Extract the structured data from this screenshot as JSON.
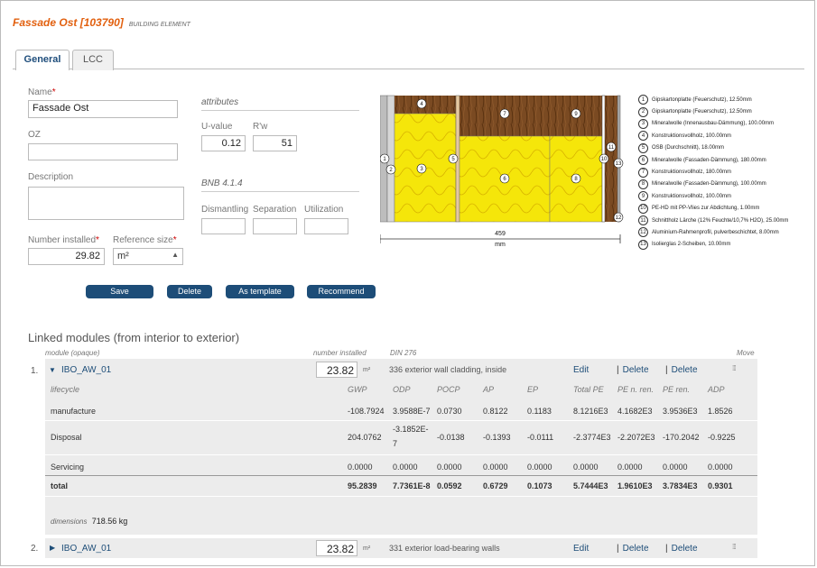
{
  "header": {
    "title": "Fassade Ost [103790]",
    "subtitle": "BUILDING ELEMENT"
  },
  "tabs": [
    {
      "label": "General"
    },
    {
      "label": "LCC"
    }
  ],
  "form": {
    "name_label": "Name",
    "name_value": "Fassade Ost",
    "oz_label": "OZ",
    "oz_value": "",
    "description_label": "Description",
    "description_value": "",
    "number_installed_label": "Number installed",
    "number_installed_value": "29.82",
    "reference_size_label": "Reference size",
    "reference_size_value": "m²"
  },
  "attributes": {
    "heading": "attributes",
    "u_value_label": "U-value",
    "u_value": "0.12",
    "rw_label": "R'w",
    "rw_value": "51"
  },
  "bnb": {
    "heading": "BNB 4.1.4",
    "dismantling_label": "Dismantling",
    "separation_label": "Separation",
    "utilization_label": "Utilization"
  },
  "buttons": {
    "save": "Save",
    "delete": "Delete",
    "as_template": "As template",
    "recommend": "Recommend"
  },
  "diagram": {
    "dimension_value": "459",
    "dimension_unit": "mm"
  },
  "legend": [
    {
      "num": "1",
      "text": "Gipskartonplatte (Feuerschutz), 12.50mm"
    },
    {
      "num": "2",
      "text": "Gipskartonplatte (Feuerschutz), 12.50mm"
    },
    {
      "num": "3",
      "text": "Mineralwolle (Innenausbau-Dämmung), 100.00mm"
    },
    {
      "num": "4",
      "text": "Konstruktionsvollholz, 100.00mm"
    },
    {
      "num": "5",
      "text": "OSB (Durchschnitt), 18.00mm"
    },
    {
      "num": "6",
      "text": "Mineralwolle (Fassaden-Dämmung), 180.00mm"
    },
    {
      "num": "7",
      "text": "Konstruktionsvollholz, 180.00mm"
    },
    {
      "num": "8",
      "text": "Mineralwolle (Fassaden-Dämmung), 100.00mm"
    },
    {
      "num": "9",
      "text": "Konstruktionsvollholz, 100.00mm"
    },
    {
      "num": "10",
      "text": "PE-HD mit PP-Vlies zur Abdichtung, 1.00mm"
    },
    {
      "num": "11",
      "text": "Schnittholz Lärche (12% Feuchte/10,7% H2O), 25.00mm"
    },
    {
      "num": "12",
      "text": "Aluminium-Rahmenprofil, pulverbeschichtet, 8.00mm"
    },
    {
      "num": "13",
      "text": "Isolierglas 2-Scheiben, 10.00mm"
    }
  ],
  "linked": {
    "title": "Linked modules (from interior to exterior)",
    "col_module": "module (opaque)",
    "col_number": "number installed",
    "col_din": "DIN 276",
    "col_move": "Move",
    "edit_label": "Edit",
    "delete_label": "Delete",
    "separator": "|",
    "modules": [
      {
        "index": "1.",
        "name": "IBO_AW_01",
        "qty": "23.82",
        "unit": "m²",
        "din": "336 exterior wall cladding, inside",
        "lifecycle_headers": [
          "lifecycle",
          "GWP",
          "ODP",
          "POCP",
          "AP",
          "EP",
          "Total PE",
          "PE n. ren.",
          "PE ren.",
          "ADP"
        ],
        "rows": [
          {
            "label": "manufacture",
            "values": [
              "-108.7924",
              "3.9588E-7",
              "0.0730",
              "0.8122",
              "0.1183",
              "8.1216E3",
              "4.1682E3",
              "3.9536E3",
              "1.8526"
            ]
          },
          {
            "label": "Disposal",
            "values": [
              "204.0762",
              "-3.1852E-",
              "-0.0138",
              "-0.1393",
              "-0.0111",
              "-2.3774E3",
              "-2.2072E3",
              "-170.2042",
              "-0.9225"
            ],
            "odp_wrap": "7"
          },
          {
            "label": "Servicing",
            "values": [
              "0.0000",
              "0.0000",
              "0.0000",
              "0.0000",
              "0.0000",
              "0.0000",
              "0.0000",
              "0.0000",
              "0.0000"
            ]
          },
          {
            "label": "total",
            "values": [
              "95.2839",
              "7.7361E-8",
              "0.0592",
              "0.6729",
              "0.1073",
              "5.7444E3",
              "1.9610E3",
              "3.7834E3",
              "0.9301"
            ]
          }
        ],
        "dimensions_label": "dimensions",
        "dimensions_value": "718.56 kg"
      },
      {
        "index": "2.",
        "name": "IBO_AW_01",
        "qty": "23.82",
        "unit": "m²",
        "din": "331 exterior load-bearing walls"
      }
    ]
  }
}
